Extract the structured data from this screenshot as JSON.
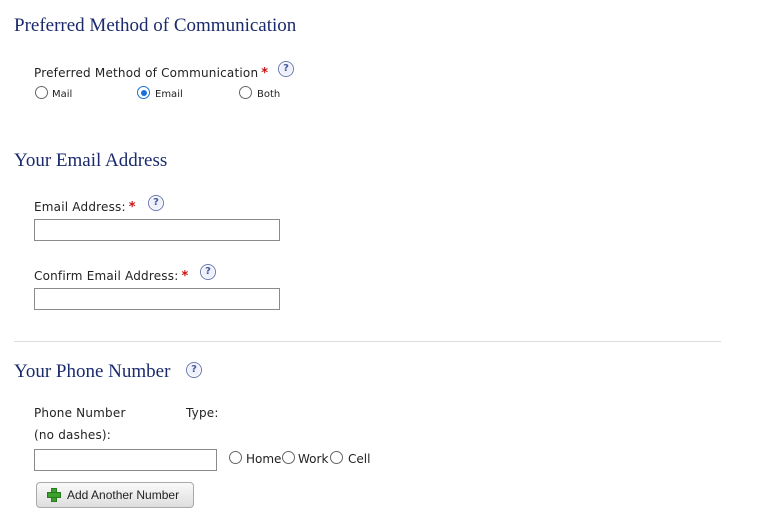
{
  "comm_section": {
    "heading": "Preferred Method of Communication",
    "field_label": "Preferred Method of Communication",
    "required_mark": "*",
    "options": [
      {
        "label": "Mail",
        "checked": false
      },
      {
        "label": "Email",
        "checked": true
      },
      {
        "label": "Both",
        "checked": false
      }
    ]
  },
  "email_section": {
    "heading": "Your Email Address",
    "email_label": "Email Address:",
    "confirm_label": "Confirm Email Address:",
    "required_mark": "*",
    "email_value": "",
    "confirm_value": ""
  },
  "phone_section": {
    "heading": "Your Phone Number",
    "number_label_line1": "Phone Number",
    "number_label_line2": "(no dashes):",
    "type_label": "Type:",
    "number_value": "",
    "type_options": [
      {
        "label": "Home",
        "checked": false
      },
      {
        "label": "Work",
        "checked": false
      },
      {
        "label": "Cell",
        "checked": false
      }
    ],
    "add_button_label": "Add Another Number"
  },
  "icons": {
    "help": "help-circle-icon",
    "add": "plus-icon"
  },
  "colors": {
    "heading": "#1a2a6c",
    "required": "#cc1111",
    "radio_selected": "#1a6fd9"
  }
}
